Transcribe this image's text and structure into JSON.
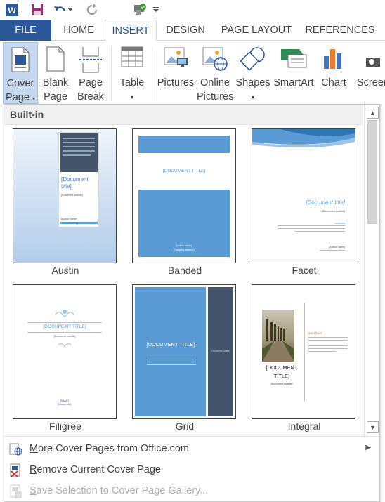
{
  "quick_access": {
    "icons": [
      "word-logo-icon",
      "save-icon",
      "undo-icon",
      "undo-dropdown-icon",
      "redo-icon",
      "format-painter-icon",
      "customize-qat-icon"
    ]
  },
  "tabs": [
    {
      "label": "FILE"
    },
    {
      "label": "HOME"
    },
    {
      "label": "INSERT",
      "active": true
    },
    {
      "label": "DESIGN"
    },
    {
      "label": "PAGE LAYOUT"
    },
    {
      "label": "REFERENCES"
    }
  ],
  "ribbon": {
    "cover_page": {
      "line1": "Cover",
      "line2": "Page"
    },
    "blank_page": {
      "line1": "Blank",
      "line2": "Page"
    },
    "page_break": {
      "line1": "Page",
      "line2": "Break"
    },
    "table": {
      "line1": "Table"
    },
    "pictures": {
      "line1": "Pictures"
    },
    "online_pictures": {
      "line1": "Online",
      "line2": "Pictures"
    },
    "shapes": {
      "line1": "Shapes"
    },
    "smartart": {
      "line1": "SmartArt"
    },
    "chart": {
      "line1": "Chart"
    },
    "screenshot": {
      "line1": "Screens"
    }
  },
  "gallery": {
    "section_title": "Built-in",
    "items": [
      {
        "name": "Austin",
        "text": "[Document title]",
        "subtitle": "[Document subtitle]",
        "author": "[Author name]"
      },
      {
        "name": "Banded",
        "text": "[DOCUMENT TITLE]",
        "author": "[Author name]",
        "address": "[Company address]"
      },
      {
        "name": "Facet",
        "text": "[Document title]",
        "subtitle": "[Document subtitle]",
        "abstract": "Abstract",
        "author": "[Author name]"
      },
      {
        "name": "Filigree",
        "text": "[DOCUMENT TITLE]",
        "subtitle": "[Document subtitle]",
        "footer1": "[NAME]",
        "footer2": "[Course title]"
      },
      {
        "name": "Grid",
        "text": "[DOCUMENT TITLE]",
        "side": "[Document subtitle]"
      },
      {
        "name": "Integral",
        "text": "[DOCUMENT TITLE]",
        "subtitle": "[Document subtitle]",
        "abstract": "ABSTRACT"
      }
    ]
  },
  "menu": [
    {
      "label": "More Cover Pages from Office.com",
      "enabled": true,
      "has_submenu": true
    },
    {
      "label": "Remove Current Cover Page",
      "enabled": true,
      "has_submenu": false
    },
    {
      "label": "Save Selection to Cover Page Gallery...",
      "enabled": false,
      "has_submenu": false
    }
  ],
  "colors": {
    "accent": "#2b579a",
    "pressed": "#c5d8ef",
    "doc_blue": "#5b9bd5",
    "slate": "#44546a"
  }
}
